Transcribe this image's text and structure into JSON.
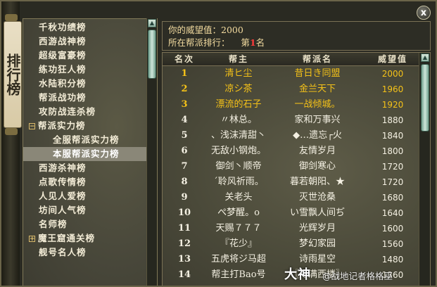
{
  "deco": {
    "label": "排行榜"
  },
  "nav": {
    "items": [
      {
        "label": "千秋功绩榜",
        "level": 0,
        "toggle": ""
      },
      {
        "label": "西游战神榜",
        "level": 0,
        "toggle": ""
      },
      {
        "label": "超级富豪榜",
        "level": 0,
        "toggle": ""
      },
      {
        "label": "练功狂人榜",
        "level": 0,
        "toggle": ""
      },
      {
        "label": "水陆积分榜",
        "level": 0,
        "toggle": ""
      },
      {
        "label": "帮派战功榜",
        "level": 0,
        "toggle": ""
      },
      {
        "label": "攻防战连杀榜",
        "level": 0,
        "toggle": ""
      },
      {
        "label": "帮派实力榜",
        "level": -1,
        "toggle": "−"
      },
      {
        "label": "全服帮派实力榜",
        "level": 1,
        "toggle": ""
      },
      {
        "label": "本服帮派实力榜",
        "level": 1,
        "toggle": "",
        "active": true
      },
      {
        "label": "西游杀神榜",
        "level": 0,
        "toggle": ""
      },
      {
        "label": "点歌传情榜",
        "level": 0,
        "toggle": ""
      },
      {
        "label": "人见人爱榜",
        "level": 0,
        "toggle": ""
      },
      {
        "label": "坊间人气榜",
        "level": 0,
        "toggle": ""
      },
      {
        "label": "名师榜",
        "level": 0,
        "toggle": ""
      },
      {
        "label": "魔王窟通关榜",
        "level": -1,
        "toggle": "+"
      },
      {
        "label": "舰号名人榜",
        "level": 0,
        "toggle": ""
      }
    ]
  },
  "info": {
    "prestige_label": "你的威望值：",
    "prestige_value": "2000",
    "rank_label": "所在帮派排行：",
    "rank_prefix": "第",
    "rank_value": "1",
    "rank_suffix": "名"
  },
  "close": {
    "label": "x"
  },
  "table": {
    "headers": [
      "名次",
      "帮主",
      "帮派名",
      "威望值"
    ],
    "rows": [
      {
        "rank": "1",
        "leader": "清ヒ尘",
        "guild": "昔日き同盟",
        "prestige": "2000",
        "top": true
      },
      {
        "rank": "2",
        "leader": "凉シ茶",
        "guild": "金兰天下",
        "prestige": "1960",
        "top": true
      },
      {
        "rank": "3",
        "leader": "漂流的石子",
        "guild": "一战倾城。",
        "prestige": "1920",
        "top": true
      },
      {
        "rank": "4",
        "leader": "〃林总。",
        "guild": "家和万事兴",
        "prestige": "1880",
        "top": false
      },
      {
        "rank": "5",
        "leader": "、浅沫清甜丶",
        "guild": "◆…遗忘┌火",
        "prestige": "1840",
        "top": false
      },
      {
        "rank": "6",
        "leader": "无敌小钢炮。",
        "guild": "友情岁月",
        "prestige": "1800",
        "top": false
      },
      {
        "rank": "7",
        "leader": "御剑丶顺帝",
        "guild": "御剑寒心",
        "prestige": "1720",
        "top": false
      },
      {
        "rank": "8",
        "leader": "ˊ聆风祈雨。",
        "guild": "暮若朝阳、★",
        "prestige": "1720",
        "top": false
      },
      {
        "rank": "9",
        "leader": "关老头",
        "guild": "灭世沧桑",
        "prestige": "1680",
        "top": false
      },
      {
        "rank": "10",
        "leader": "ぺ梦醒。o",
        "guild": "い雪飘人间ぢ",
        "prestige": "1640",
        "top": false
      },
      {
        "rank": "11",
        "leader": "天赐７７７",
        "guild": "光辉岁月",
        "prestige": "1600",
        "top": false
      },
      {
        "rank": "12",
        "leader": "『花少』",
        "guild": "梦幻家园",
        "prestige": "1560",
        "top": false
      },
      {
        "rank": "13",
        "leader": "五虎将ジ马超",
        "guild": "诗雨星空",
        "prestige": "1480",
        "top": false
      },
      {
        "rank": "14",
        "leader": "帮主打Bao号",
        "guild": "〖月满西楼〗",
        "prestige": "1360",
        "top": false
      }
    ]
  },
  "watermark": {
    "logo": "大神",
    "text": "@战地记者格格巫"
  }
}
